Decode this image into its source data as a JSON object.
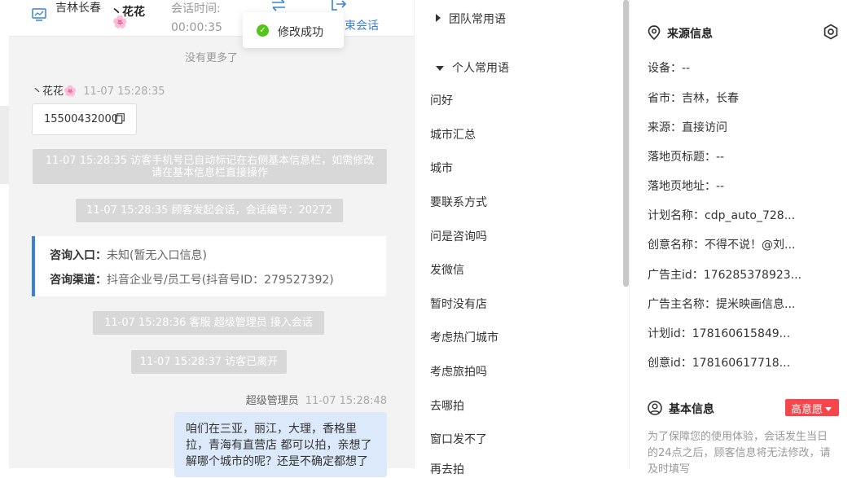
{
  "header": {
    "location": "吉林长春",
    "visitor_name": "丶花花",
    "visitor_flower": "🌸",
    "session_time_label": "会话时间:",
    "session_time": "00:00:35",
    "end_label": "结束会话"
  },
  "toast": {
    "text": "修改成功"
  },
  "chat": {
    "no_more": "没有更多了",
    "visitor_msg": {
      "name": "丶花花🌸",
      "time": "11-07 15:28:35",
      "phone": "15500432000"
    },
    "system_messages": [
      "11-07 15:28:35 访客手机号已自动标记在右侧基本信息栏，如需修改请在基本信息栏直接操作",
      "11-07 15:28:35 顾客发起会话，会话编号：20272",
      "11-07 15:28:36 客服 超级管理员 接入会话",
      "11-07 15:28:37 访客已离开"
    ],
    "consult": {
      "entry_label": "咨询入口：",
      "entry_value": "未知(暂无入口信息)",
      "channel_label": "咨询渠道：",
      "channel_value": "抖音企业号/员工号(抖音号ID：279527392)"
    },
    "agent_msg": {
      "name": "超级管理员",
      "time": "11-07 15:28:48",
      "text": "咱们在三亚，丽江，大理，香格里拉，青海有直营店 都可以拍，亲想了解哪个城市的呢？还是不确定都想了"
    }
  },
  "phrases": {
    "team_group": "团队常用语",
    "personal_group": "个人常用语",
    "items": [
      "问好",
      "城市汇总",
      "城市",
      "要联系方式",
      "问是咨询吗",
      "发微信",
      "暂时没有店",
      "考虑热门城市",
      "考虑旅拍吗",
      "去哪拍",
      "窗口发不了",
      "再去拍"
    ]
  },
  "info": {
    "source_title": "来源信息",
    "rows": [
      "设备：--",
      "省市：吉林，长春",
      "来源：直接访问",
      "落地页标题：--",
      "落地页地址：--",
      "计划名称：cdp_auto_728...",
      "创意名称：不得不说！@刘...",
      "广告主id：176285378923...",
      "广告主名称：提米映画信息...",
      "计划id：178160615849...",
      "创意id：178160617718..."
    ],
    "basic_title": "基本信息",
    "intent_tag": "高意愿",
    "notice": "为了保障您的使用体验，会话发生当日的24点之后，顾客信息将无法修改，请及时填写"
  }
}
